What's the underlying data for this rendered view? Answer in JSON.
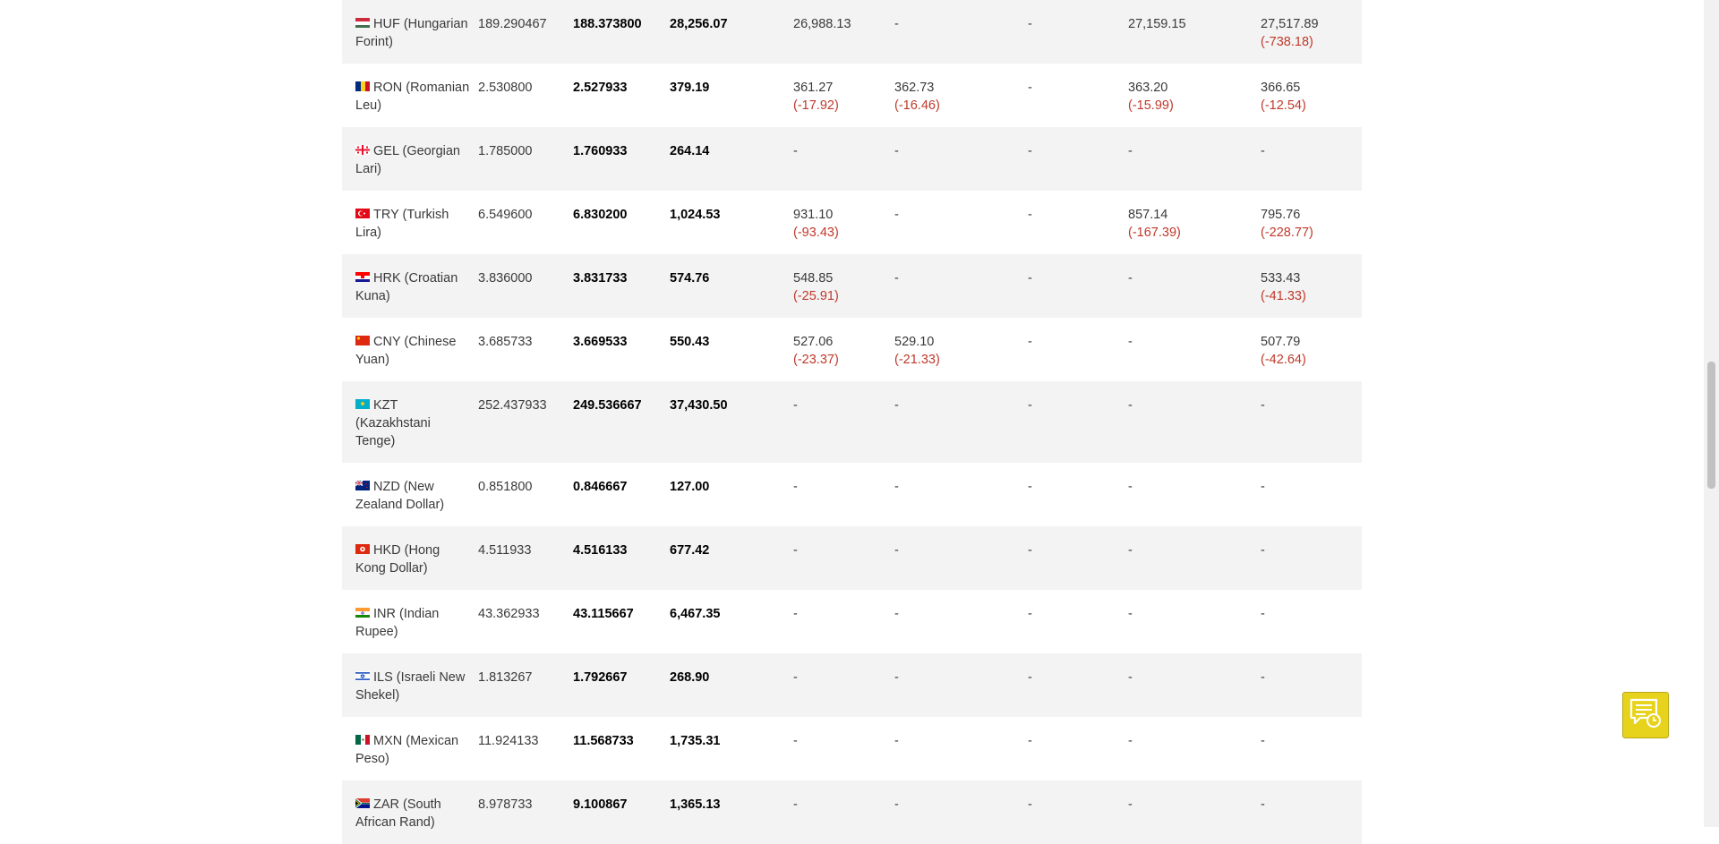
{
  "rows": [
    {
      "flag": "hu",
      "currency": "HUF (Hungarian Forint)",
      "buy": "189.290467",
      "sell": "188.373800",
      "amount": "28,256.07",
      "v1": "26,988.13",
      "c1": "",
      "v2": "-",
      "c2": "",
      "v3": "-",
      "c3": "",
      "v4": "27,159.15",
      "c4": "",
      "v5": "27,517.89",
      "c5": "(-738.18)"
    },
    {
      "flag": "ro",
      "currency": "RON (Romanian Leu)",
      "buy": "2.530800",
      "sell": "2.527933",
      "amount": "379.19",
      "v1": "361.27",
      "c1": "(-17.92)",
      "v2": "362.73",
      "c2": "(-16.46)",
      "v3": "-",
      "c3": "",
      "v4": "363.20",
      "c4": "(-15.99)",
      "v5": "366.65",
      "c5": "(-12.54)"
    },
    {
      "flag": "ge",
      "currency": "GEL (Georgian Lari)",
      "buy": "1.785000",
      "sell": "1.760933",
      "amount": "264.14",
      "v1": "-",
      "c1": "",
      "v2": "-",
      "c2": "",
      "v3": "-",
      "c3": "",
      "v4": "-",
      "c4": "",
      "v5": "-",
      "c5": ""
    },
    {
      "flag": "tr",
      "currency": "TRY (Turkish Lira)",
      "buy": "6.549600",
      "sell": "6.830200",
      "amount": "1,024.53",
      "v1": "931.10",
      "c1": "(-93.43)",
      "v2": "-",
      "c2": "",
      "v3": "-",
      "c3": "",
      "v4": "857.14",
      "c4": "(-167.39)",
      "v5": "795.76",
      "c5": "(-228.77)"
    },
    {
      "flag": "hr",
      "currency": "HRK (Croatian Kuna)",
      "buy": "3.836000",
      "sell": "3.831733",
      "amount": "574.76",
      "v1": "548.85",
      "c1": "(-25.91)",
      "v2": "-",
      "c2": "",
      "v3": "-",
      "c3": "",
      "v4": "-",
      "c4": "",
      "v5": "533.43",
      "c5": "(-41.33)"
    },
    {
      "flag": "cn",
      "currency": "CNY (Chinese Yuan)",
      "buy": "3.685733",
      "sell": "3.669533",
      "amount": "550.43",
      "v1": "527.06",
      "c1": "(-23.37)",
      "v2": "529.10",
      "c2": "(-21.33)",
      "v3": "-",
      "c3": "",
      "v4": "-",
      "c4": "",
      "v5": "507.79",
      "c5": "(-42.64)"
    },
    {
      "flag": "kz",
      "currency": "KZT (Kazakhstani Tenge)",
      "buy": "252.437933",
      "sell": "249.536667",
      "amount": "37,430.50",
      "v1": "-",
      "c1": "",
      "v2": "-",
      "c2": "",
      "v3": "-",
      "c3": "",
      "v4": "-",
      "c4": "",
      "v5": "-",
      "c5": ""
    },
    {
      "flag": "nz",
      "currency": "NZD (New Zealand Dollar)",
      "buy": "0.851800",
      "sell": "0.846667",
      "amount": "127.00",
      "v1": "-",
      "c1": "",
      "v2": "-",
      "c2": "",
      "v3": "-",
      "c3": "",
      "v4": "-",
      "c4": "",
      "v5": "-",
      "c5": ""
    },
    {
      "flag": "hk",
      "currency": "HKD (Hong Kong Dollar)",
      "buy": "4.511933",
      "sell": "4.516133",
      "amount": "677.42",
      "v1": "-",
      "c1": "",
      "v2": "-",
      "c2": "",
      "v3": "-",
      "c3": "",
      "v4": "-",
      "c4": "",
      "v5": "-",
      "c5": ""
    },
    {
      "flag": "in",
      "currency": "INR (Indian Rupee)",
      "buy": "43.362933",
      "sell": "43.115667",
      "amount": "6,467.35",
      "v1": "-",
      "c1": "",
      "v2": "-",
      "c2": "",
      "v3": "-",
      "c3": "",
      "v4": "-",
      "c4": "",
      "v5": "-",
      "c5": ""
    },
    {
      "flag": "il",
      "currency": "ILS (Israeli New Shekel)",
      "buy": "1.813267",
      "sell": "1.792667",
      "amount": "268.90",
      "v1": "-",
      "c1": "",
      "v2": "-",
      "c2": "",
      "v3": "-",
      "c3": "",
      "v4": "-",
      "c4": "",
      "v5": "-",
      "c5": ""
    },
    {
      "flag": "mx",
      "currency": "MXN (Mexican Peso)",
      "buy": "11.924133",
      "sell": "11.568733",
      "amount": "1,735.31",
      "v1": "-",
      "c1": "",
      "v2": "-",
      "c2": "",
      "v3": "-",
      "c3": "",
      "v4": "-",
      "c4": "",
      "v5": "-",
      "c5": ""
    },
    {
      "flag": "za",
      "currency": "ZAR (South African Rand)",
      "buy": "8.978733",
      "sell": "9.100867",
      "amount": "1,365.13",
      "v1": "-",
      "c1": "",
      "v2": "-",
      "c2": "",
      "v3": "-",
      "c3": "",
      "v4": "-",
      "c4": "",
      "v5": "-",
      "c5": ""
    }
  ],
  "colors": {
    "negative": "#c0392b",
    "row_alt": "#f3f3f3",
    "chat_button": "#e8d31c"
  },
  "chat_button": {
    "icon": "chat-schedule-icon"
  }
}
